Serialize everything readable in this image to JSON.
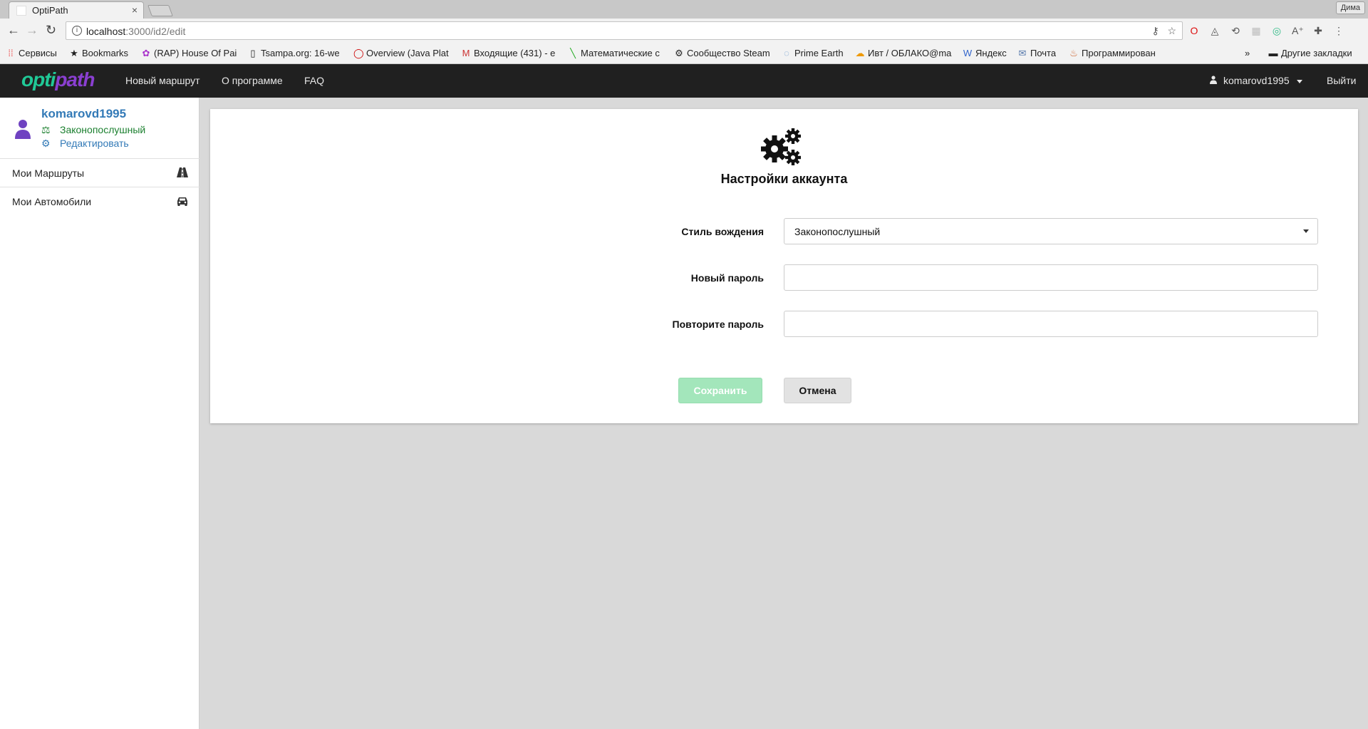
{
  "browser": {
    "tab_title": "OptiPath",
    "tab_close": "×",
    "user_label": "Дима",
    "url_host": "localhost",
    "url_path": ":3000/id2/edit",
    "bookmarks": [
      {
        "label": "Сервисы",
        "icon": "apps-grid-icon"
      },
      {
        "label": "Bookmarks",
        "icon": "star-icon"
      },
      {
        "label": "(RAP) House Of Pai",
        "icon": "rap-icon"
      },
      {
        "label": "Tsampa.org: 16-we",
        "icon": "page-icon"
      },
      {
        "label": "Overview (Java Plat",
        "icon": "oracle-icon"
      },
      {
        "label": "Входящие (431) - e",
        "icon": "gmail-icon"
      },
      {
        "label": "Математические с",
        "icon": "math-icon"
      },
      {
        "label": "Сообщество Steam",
        "icon": "steam-icon"
      },
      {
        "label": "Prime Earth",
        "icon": "speech-icon"
      },
      {
        "label": "Ивт / ОБЛАКО@ma",
        "icon": "cloud-icon"
      },
      {
        "label": "Яндекс",
        "icon": "wiki-icon"
      },
      {
        "label": "Почта",
        "icon": "mail-icon"
      },
      {
        "label": "Программирован",
        "icon": "java-icon"
      }
    ],
    "bookmarks_more": "»",
    "other_bookmarks": "Другие закладки"
  },
  "navbar": {
    "logo_part1": "opti",
    "logo_part2": "path",
    "links": [
      "Новый маршрут",
      "О программе",
      "FAQ"
    ],
    "username": "komarovd1995",
    "logout": "Выйти"
  },
  "sidebar": {
    "username": "komarovd1995",
    "driving_style": "Законопослушный",
    "edit_label": "Редактировать",
    "items": [
      {
        "label": "Мои Маршруты",
        "icon": "road-icon"
      },
      {
        "label": "Мои Автомобили",
        "icon": "car-icon"
      }
    ]
  },
  "form": {
    "title": "Настройки аккаунта",
    "driving_style_label": "Стиль вождения",
    "driving_style_value": "Законопослушный",
    "new_password_label": "Новый пароль",
    "new_password_value": "",
    "repeat_password_label": "Повторите пароль",
    "repeat_password_value": "",
    "save_label": "Сохранить",
    "cancel_label": "Отмена"
  },
  "colors": {
    "navbar_bg": "#202020",
    "logo_purple": "#8a3fd1",
    "logo_green": "#20c997",
    "link_blue": "#337ab7",
    "status_green": "#1a7f2e",
    "save_disabled": "#a3e6bb"
  }
}
